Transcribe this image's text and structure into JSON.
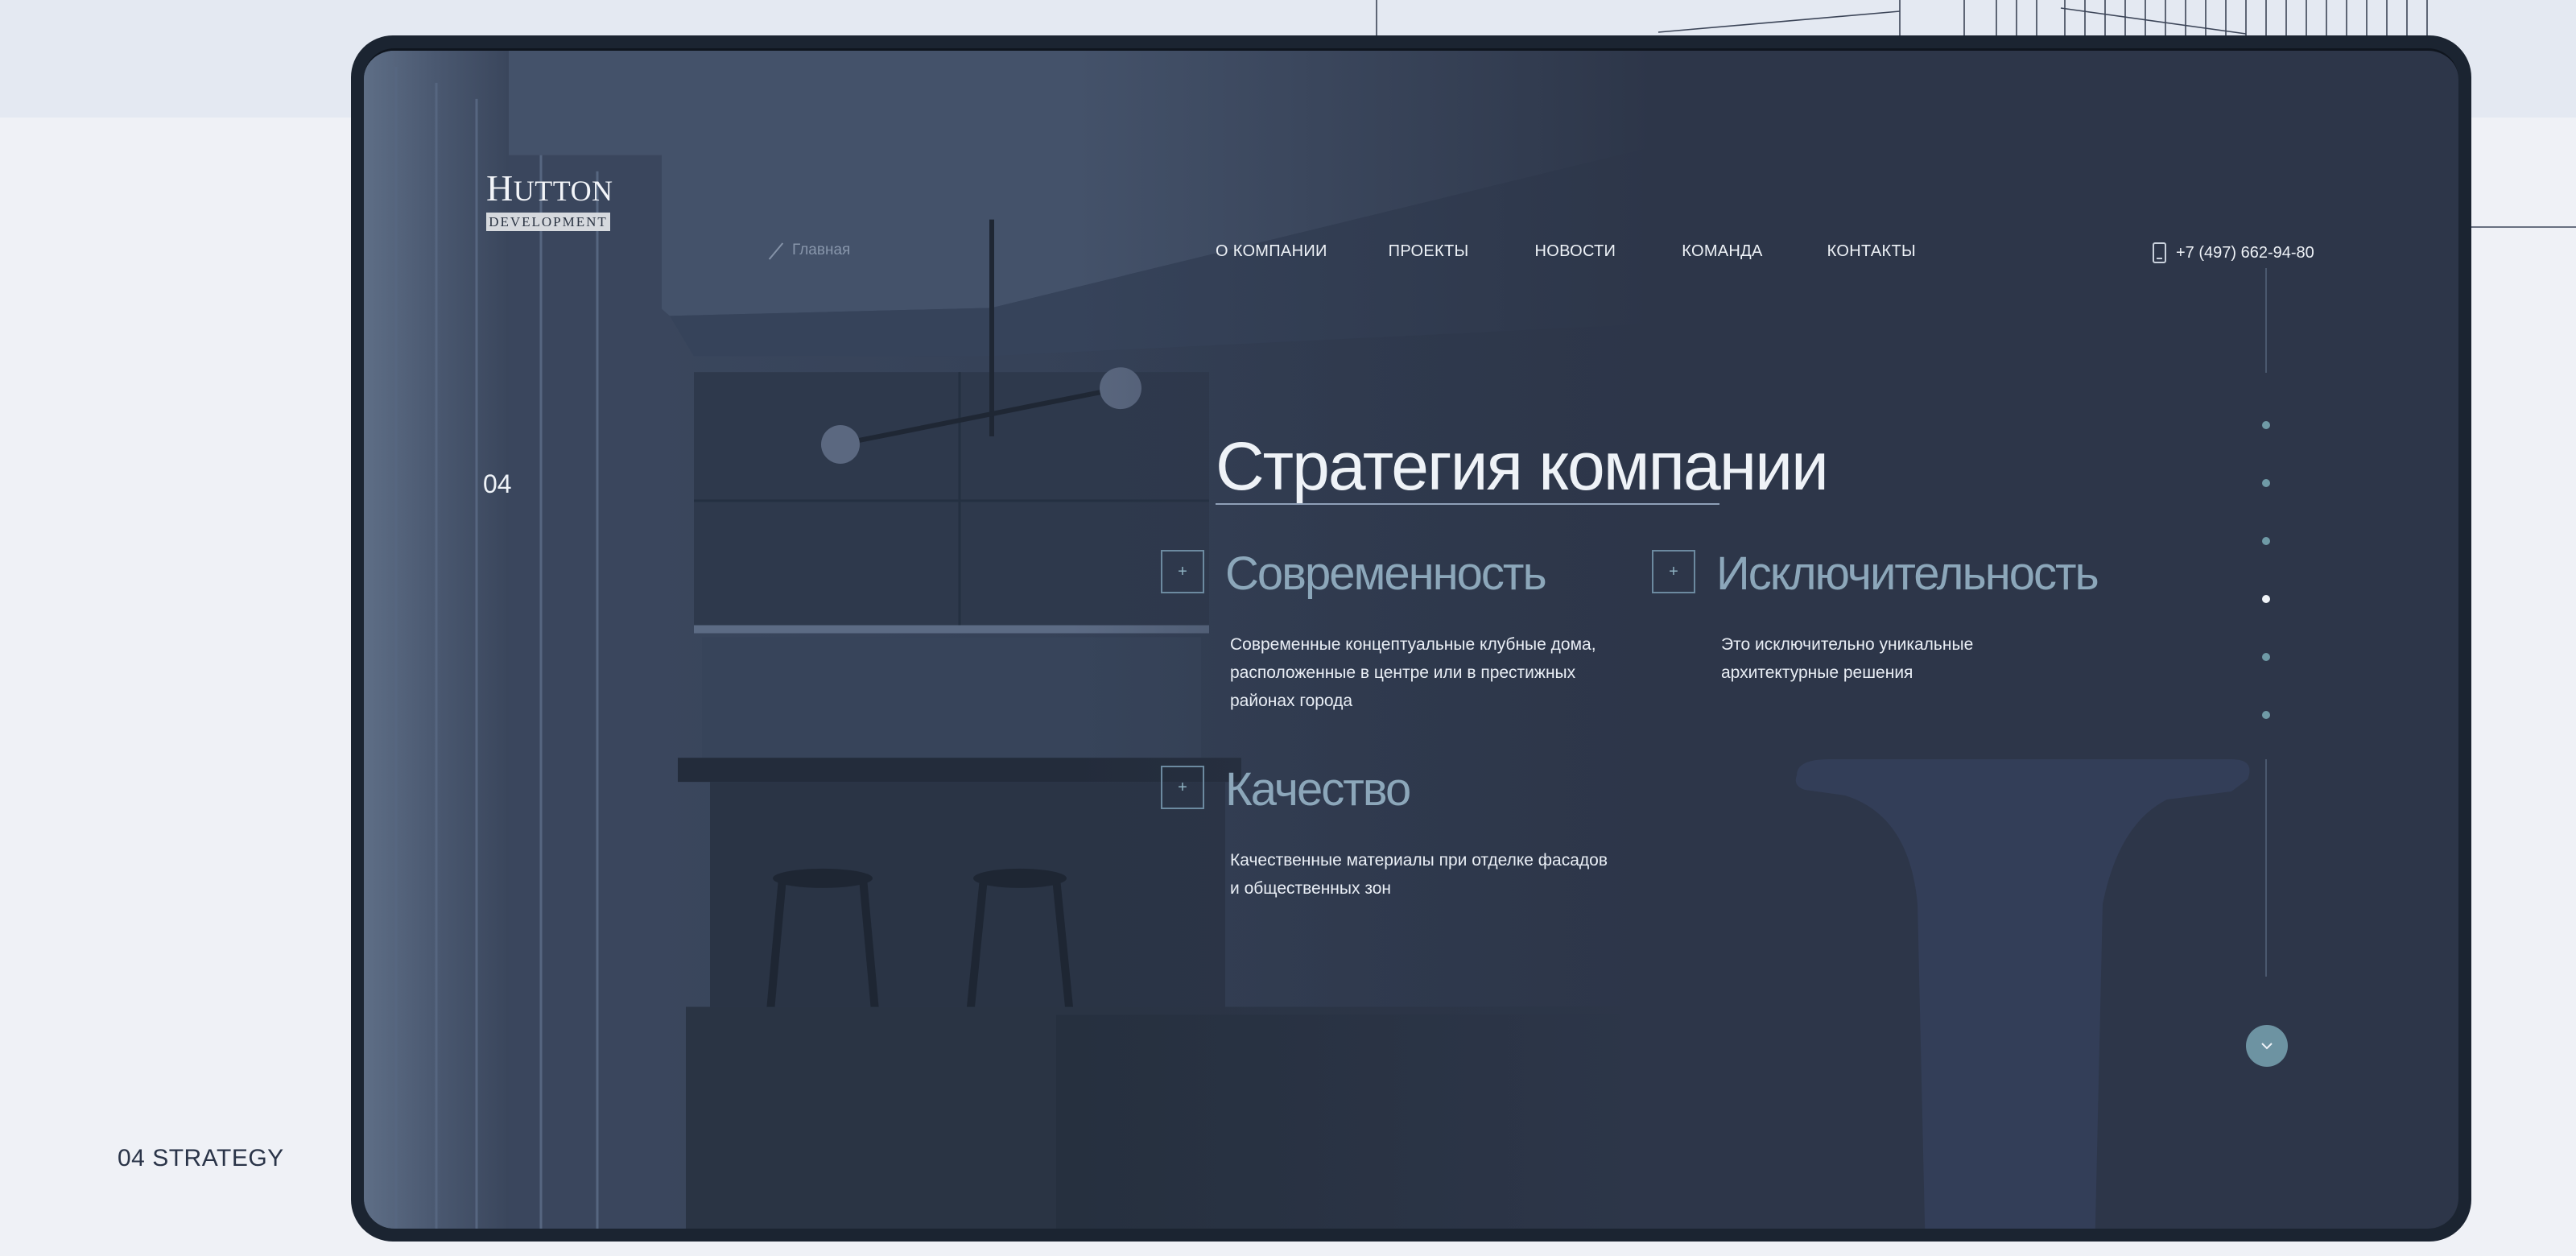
{
  "page_caption": "04 STRATEGY",
  "colors": {
    "background": "#eff1f6",
    "device_frame": "#1b2431",
    "screen": "#2d3649",
    "accent": "#6d93a2",
    "text": "#eef2f7"
  },
  "header": {
    "logo": {
      "word": "Hutton",
      "sub": "DEVELOPMENT"
    },
    "breadcrumb": {
      "label": "Главная"
    },
    "nav": [
      "О КОМПАНИИ",
      "ПРОЕКТЫ",
      "НОВОСТИ",
      "КОМАНДА",
      "КОНТАКТЫ"
    ],
    "phone": {
      "icon": "phone-icon",
      "number": "+7 (497) 662-94-80"
    }
  },
  "section": {
    "number": "04",
    "heading": "Стратегия компании",
    "features": [
      {
        "icon": "plus-icon",
        "title": "Современность",
        "text_lines": [
          "Современные концептуальные клубные дома,",
          "расположенные в центре или в престижных",
          "районах города"
        ]
      },
      {
        "icon": "plus-icon",
        "title": "Исключительность",
        "text_lines": [
          "Это исключительно уникальные",
          "архитектурные решения"
        ]
      },
      {
        "icon": "plus-icon",
        "title": "Качество",
        "text_lines": [
          "Качественные материалы при отделке фасадов",
          "и общественных зон"
        ]
      }
    ]
  },
  "pagination": {
    "total": 6,
    "active": 4
  },
  "scroll_button": {
    "icon": "chevron-down-icon"
  }
}
